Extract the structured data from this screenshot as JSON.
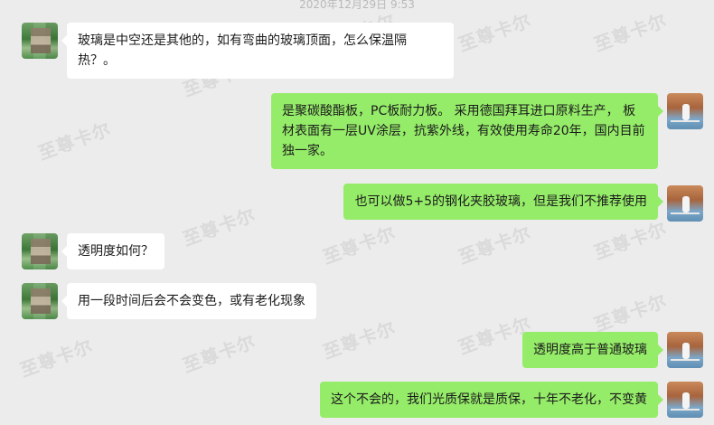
{
  "chat": {
    "timestamp": "2020年12月29日 9:53",
    "messages": [
      {
        "sender": "peer",
        "text": "玻璃是中空还是其他的，如有弯曲的玻璃顶面，怎么保温隔热？。"
      },
      {
        "sender": "self",
        "text": "是聚碳酸酯板，PC板耐力板。  采用德国拜耳进口原料生产， 板材表面有一层UV涂层，抗紫外线，有效使用寿命20年，国内目前独一家。"
      },
      {
        "sender": "self",
        "text": "也可以做5+5的钢化夹胶玻璃，但是我们不推荐使用"
      },
      {
        "sender": "peer",
        "text": "透明度如何？"
      },
      {
        "sender": "peer",
        "text": "用一段时间后会不会变色，或有老化现象"
      },
      {
        "sender": "self",
        "text": "透明度高于普通玻璃"
      },
      {
        "sender": "self",
        "text": "这个不会的，我们光质保就是质保，十年不老化，不变黄"
      }
    ]
  },
  "watermark": {
    "text": "至尊卡尔"
  },
  "colors": {
    "self_bubble": "#95ec69",
    "peer_bubble": "#ffffff",
    "background": "#ececec"
  }
}
